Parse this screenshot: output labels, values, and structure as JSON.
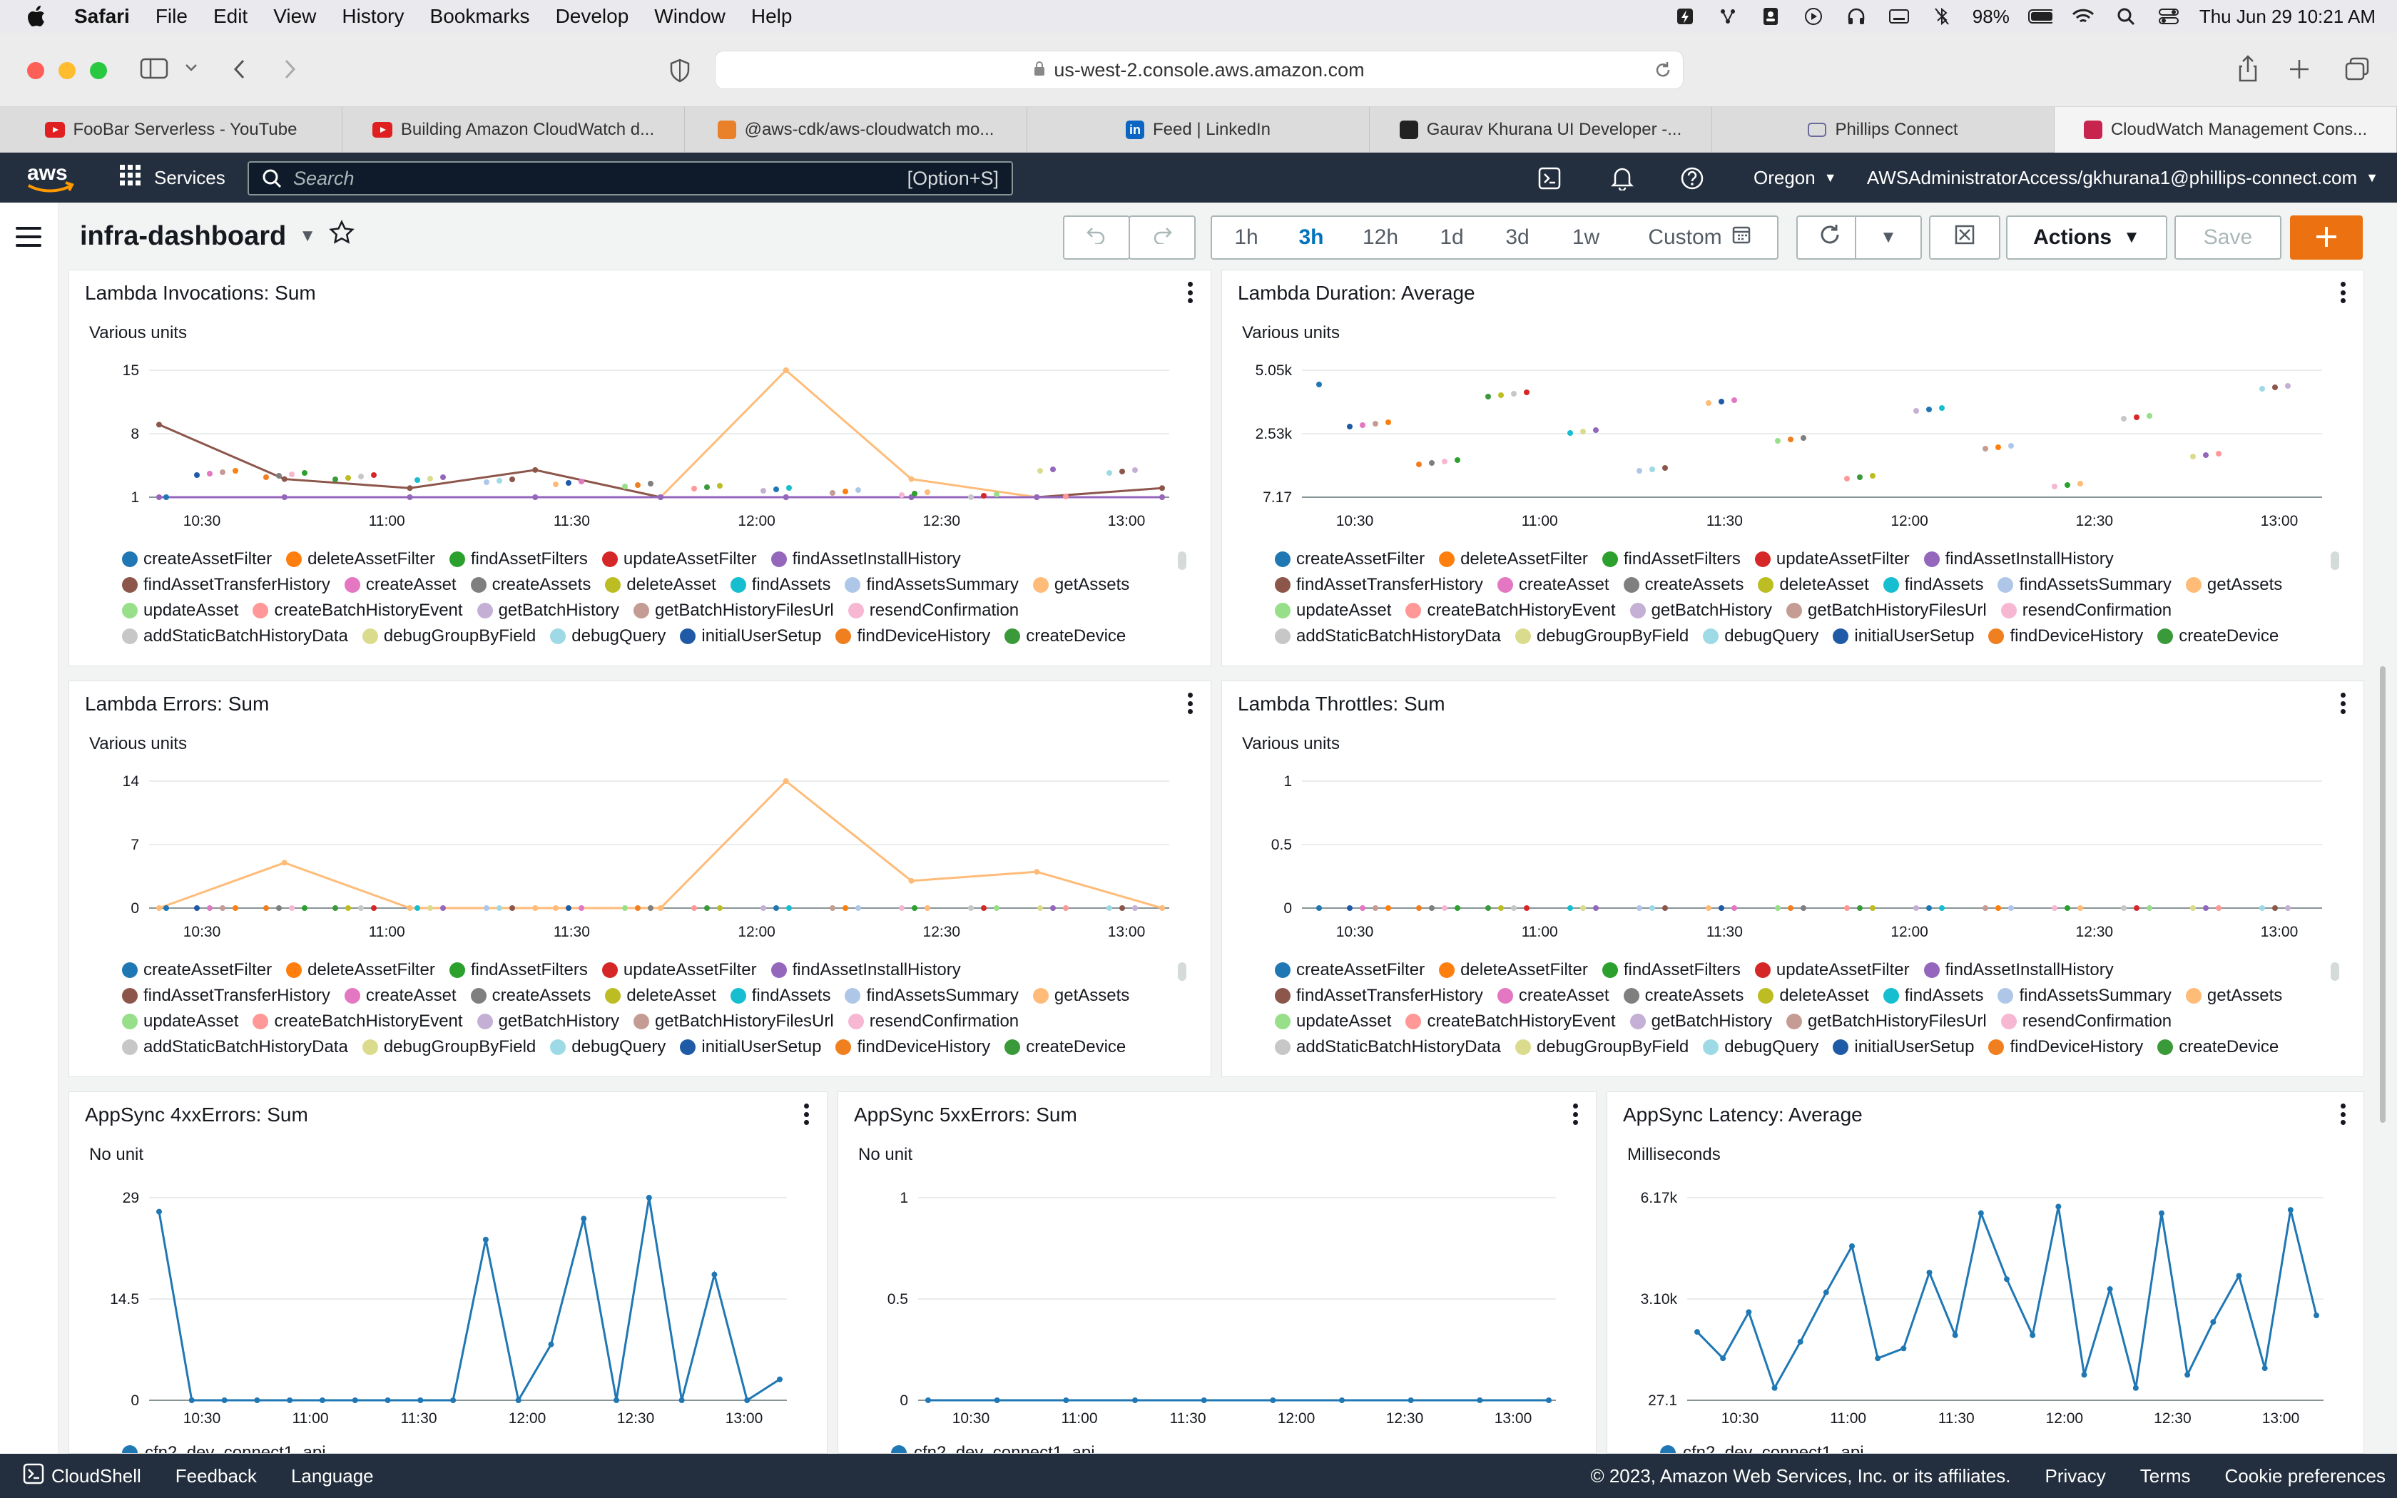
{
  "mac": {
    "app": "Safari",
    "menus": [
      "File",
      "Edit",
      "View",
      "History",
      "Bookmarks",
      "Develop",
      "Window",
      "Help"
    ],
    "battery": "98%",
    "datetime": "Thu Jun 29  10:21 AM"
  },
  "browser": {
    "url": "us-west-2.console.aws.amazon.com",
    "tabs": [
      {
        "label": "FooBar Serverless - YouTube",
        "fav": "#e02020"
      },
      {
        "label": "Building Amazon CloudWatch d...",
        "fav": "#e02020"
      },
      {
        "label": "@aws-cdk/aws-cloudwatch mo...",
        "fav": "#e9812b"
      },
      {
        "label": "Feed | LinkedIn",
        "fav": "#0a66c2"
      },
      {
        "label": "Gaurav Khurana UI Developer -...",
        "fav": "#222222"
      },
      {
        "label": "Phillips Connect",
        "fav": "#6a6a9a"
      },
      {
        "label": "CloudWatch Management Cons...",
        "fav": "#c7254e"
      }
    ]
  },
  "aws_nav": {
    "logo_text": "aws",
    "services_label": "Services",
    "search_placeholder": "Search",
    "search_shortcut": "[Option+S]",
    "region": "Oregon",
    "account": "AWSAdministratorAccess/gkhurana1@phillips-connect.com"
  },
  "dashboard": {
    "title": "infra-dashboard",
    "time_ranges": [
      "1h",
      "3h",
      "12h",
      "1d",
      "3d",
      "1w"
    ],
    "selected_range": "3h",
    "custom_label": "Custom",
    "actions_label": "Actions",
    "save_label": "Save"
  },
  "lambda_series": [
    {
      "name": "createAssetFilter",
      "color": "#1f77b4"
    },
    {
      "name": "deleteAssetFilter",
      "color": "#ff7f0e"
    },
    {
      "name": "findAssetFilters",
      "color": "#2ca02c"
    },
    {
      "name": "updateAssetFilter",
      "color": "#d62728"
    },
    {
      "name": "findAssetInstallHistory",
      "color": "#9467bd"
    },
    {
      "name": "findAssetTransferHistory",
      "color": "#8c564b"
    },
    {
      "name": "createAsset",
      "color": "#e377c2"
    },
    {
      "name": "createAssets",
      "color": "#7f7f7f"
    },
    {
      "name": "deleteAsset",
      "color": "#bcbd22"
    },
    {
      "name": "findAssets",
      "color": "#17becf"
    },
    {
      "name": "findAssetsSummary",
      "color": "#aec7e8"
    },
    {
      "name": "getAssets",
      "color": "#ffbb78"
    },
    {
      "name": "updateAsset",
      "color": "#98df8a"
    },
    {
      "name": "createBatchHistoryEvent",
      "color": "#ff9896"
    },
    {
      "name": "getBatchHistory",
      "color": "#c5b0d5"
    },
    {
      "name": "getBatchHistoryFilesUrl",
      "color": "#c49c94"
    },
    {
      "name": "resendConfirmation",
      "color": "#f7b6d2"
    },
    {
      "name": "addStaticBatchHistoryData",
      "color": "#c7c7c7"
    },
    {
      "name": "debugGroupByField",
      "color": "#dbdb8d"
    },
    {
      "name": "debugQuery",
      "color": "#9edae5"
    },
    {
      "name": "initialUserSetup",
      "color": "#1f5aa6"
    },
    {
      "name": "findDeviceHistory",
      "color": "#f07f20"
    },
    {
      "name": "createDevice",
      "color": "#3a9a3a"
    }
  ],
  "widgets": {
    "invocations": {
      "title": "Lambda Invocations: Sum",
      "unit": "Various units"
    },
    "duration": {
      "title": "Lambda Duration: Average",
      "unit": "Various units"
    },
    "errors": {
      "title": "Lambda Errors: Sum",
      "unit": "Various units"
    },
    "throttles": {
      "title": "Lambda Throttles: Sum",
      "unit": "Various units"
    },
    "appsync4xx": {
      "title": "AppSync 4xxErrors: Sum",
      "unit": "No unit",
      "legend": "cfn2_dev_connect1_api"
    },
    "appsync5xx": {
      "title": "AppSync 5xxErrors: Sum",
      "unit": "No unit",
      "legend": "cfn2_dev_connect1_api"
    },
    "latency": {
      "title": "AppSync Latency: Average",
      "unit": "Milliseconds",
      "legend": "cfn2_dev_connect1_api"
    }
  },
  "chart_data": [
    {
      "id": "invocations",
      "type": "line",
      "ylabel": "Various units",
      "yticks": [
        "15",
        "8",
        "1"
      ],
      "xticks": [
        "10:30",
        "11:00",
        "11:30",
        "12:00",
        "12:30",
        "13:00"
      ],
      "ylim": [
        1,
        15
      ],
      "series": [
        {
          "name": "getAssets",
          "values": [
            1,
            1,
            1,
            1,
            1,
            15,
            3,
            1,
            1
          ]
        },
        {
          "name": "findAssetTransferHistory",
          "values": [
            9,
            3,
            2,
            4,
            1,
            1,
            1,
            1,
            2
          ]
        },
        {
          "name": "findAssetInstallHistory",
          "values": [
            1,
            1,
            1,
            1,
            1,
            1,
            1,
            1,
            1
          ]
        }
      ]
    },
    {
      "id": "duration",
      "type": "line",
      "ylabel": "Various units",
      "yticks": [
        "5.05k",
        "2.53k",
        "7.17"
      ],
      "xticks": [
        "10:30",
        "11:00",
        "11:30",
        "12:00",
        "12:30",
        "13:00"
      ],
      "ylim": [
        7.17,
        5050
      ]
    },
    {
      "id": "errors",
      "type": "line",
      "ylabel": "Various units",
      "yticks": [
        "14",
        "7",
        "0"
      ],
      "xticks": [
        "10:30",
        "11:00",
        "11:30",
        "12:00",
        "12:30",
        "13:00"
      ],
      "ylim": [
        0,
        14
      ],
      "series": [
        {
          "name": "getAssets",
          "values": [
            0,
            5,
            0,
            0,
            0,
            14,
            3,
            4,
            0
          ]
        }
      ]
    },
    {
      "id": "throttles",
      "type": "line",
      "ylabel": "Various units",
      "yticks": [
        "1",
        "0.5",
        "0"
      ],
      "xticks": [
        "10:30",
        "11:00",
        "11:30",
        "12:00",
        "12:30",
        "13:00"
      ],
      "ylim": [
        0,
        1
      ]
    },
    {
      "id": "appsync4xx",
      "type": "line",
      "ylabel": "No unit",
      "yticks": [
        "29",
        "14.5",
        "0"
      ],
      "xticks": [
        "10:30",
        "11:00",
        "11:30",
        "12:00",
        "12:30",
        "13:00"
      ],
      "ylim": [
        0,
        29
      ],
      "series": [
        {
          "name": "cfn2_dev_connect1_api",
          "values": [
            27,
            0,
            0,
            0,
            0,
            0,
            0,
            0,
            0,
            0,
            23,
            0,
            8,
            26,
            0,
            29,
            0,
            18,
            0,
            3
          ]
        }
      ]
    },
    {
      "id": "appsync5xx",
      "type": "line",
      "ylabel": "No unit",
      "yticks": [
        "1",
        "0.5",
        "0"
      ],
      "xticks": [
        "10:30",
        "11:00",
        "11:30",
        "12:00",
        "12:30",
        "13:00"
      ],
      "ylim": [
        0,
        1
      ],
      "series": [
        {
          "name": "cfn2_dev_connect1_api",
          "values": [
            0,
            0,
            0,
            0,
            0,
            0,
            0,
            0,
            0,
            0
          ]
        }
      ]
    },
    {
      "id": "latency",
      "type": "line",
      "ylabel": "Milliseconds",
      "yticks": [
        "6.17k",
        "3.10k",
        "27.1"
      ],
      "xticks": [
        "10:30",
        "11:00",
        "11:30",
        "12:00",
        "12:30",
        "13:00"
      ],
      "ylim": [
        27.1,
        6170
      ],
      "series": [
        {
          "name": "cfn2_dev_connect1_api",
          "values": [
            2100,
            1300,
            2700,
            400,
            1800,
            3300,
            4700,
            1300,
            1600,
            3900,
            2000,
            5700,
            3700,
            2000,
            5900,
            800,
            3400,
            400,
            5700,
            800,
            2400,
            3800,
            1000,
            5800,
            2600
          ]
        }
      ]
    }
  ],
  "footer": {
    "cloudshell": "CloudShell",
    "feedback": "Feedback",
    "language": "Language",
    "copyright": "© 2023, Amazon Web Services, Inc. or its affiliates.",
    "privacy": "Privacy",
    "terms": "Terms",
    "cookies": "Cookie preferences"
  }
}
